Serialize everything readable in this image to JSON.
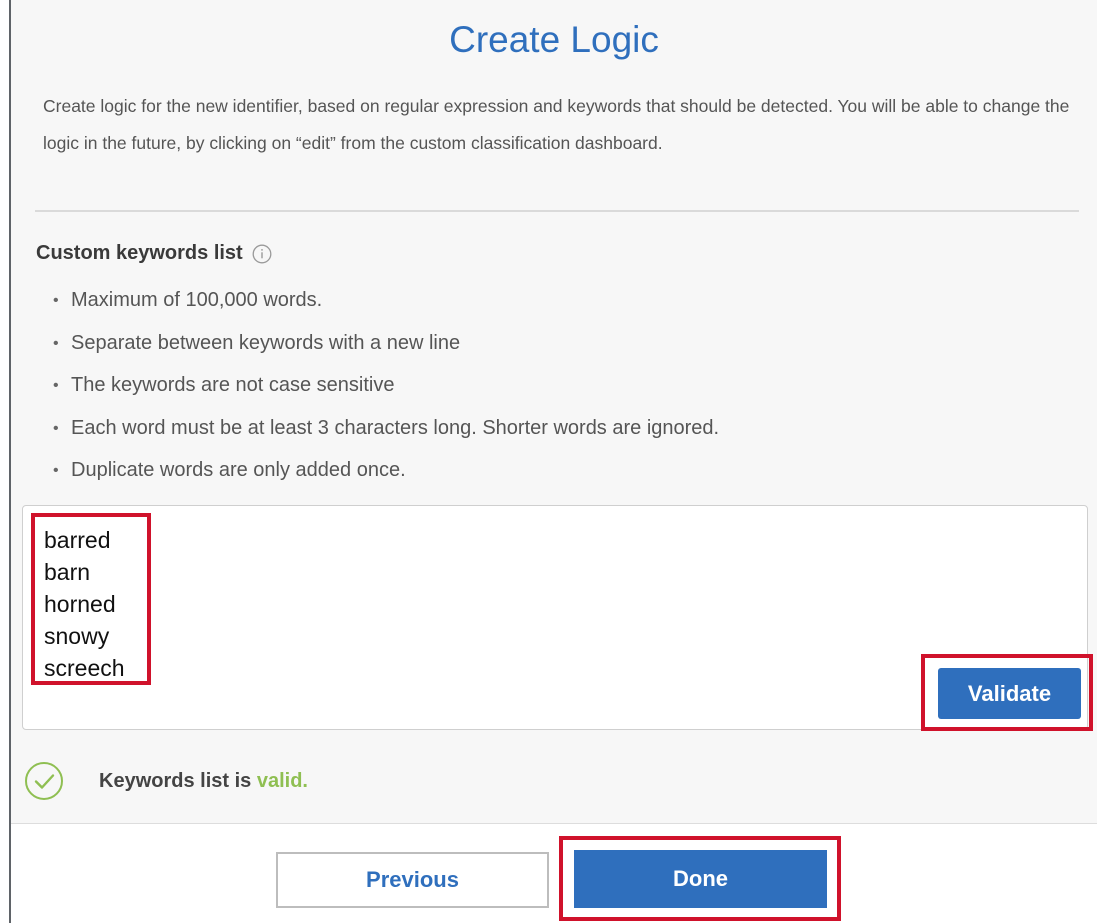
{
  "dialog": {
    "title": "Create Logic",
    "intro": "Create logic for the new identifier, based on regular expression and keywords that should be detected. You will be able to change the logic in the future, by clicking on “edit” from the custom classification dashboard."
  },
  "keywords_section": {
    "heading": "Custom keywords list",
    "info_icon": "info-circle-icon",
    "rules": [
      "Maximum of 100,000 words.",
      "Separate between keywords with a new line",
      "The keywords are not case sensitive",
      "Each word must be at least 3 characters long. Shorter words are ignored.",
      "Duplicate words are only added once."
    ],
    "keywords": [
      "barred",
      "barn",
      "horned",
      "snowy",
      "screech"
    ],
    "validate_label": "Validate"
  },
  "status": {
    "icon": "check-circle-icon",
    "text": "Keywords list is",
    "valid_word": "valid."
  },
  "footer": {
    "previous_label": "Previous",
    "done_label": "Done"
  },
  "colors": {
    "primary": "#2f6fbd",
    "highlight": "#d0122b",
    "valid": "#8fbf52"
  }
}
